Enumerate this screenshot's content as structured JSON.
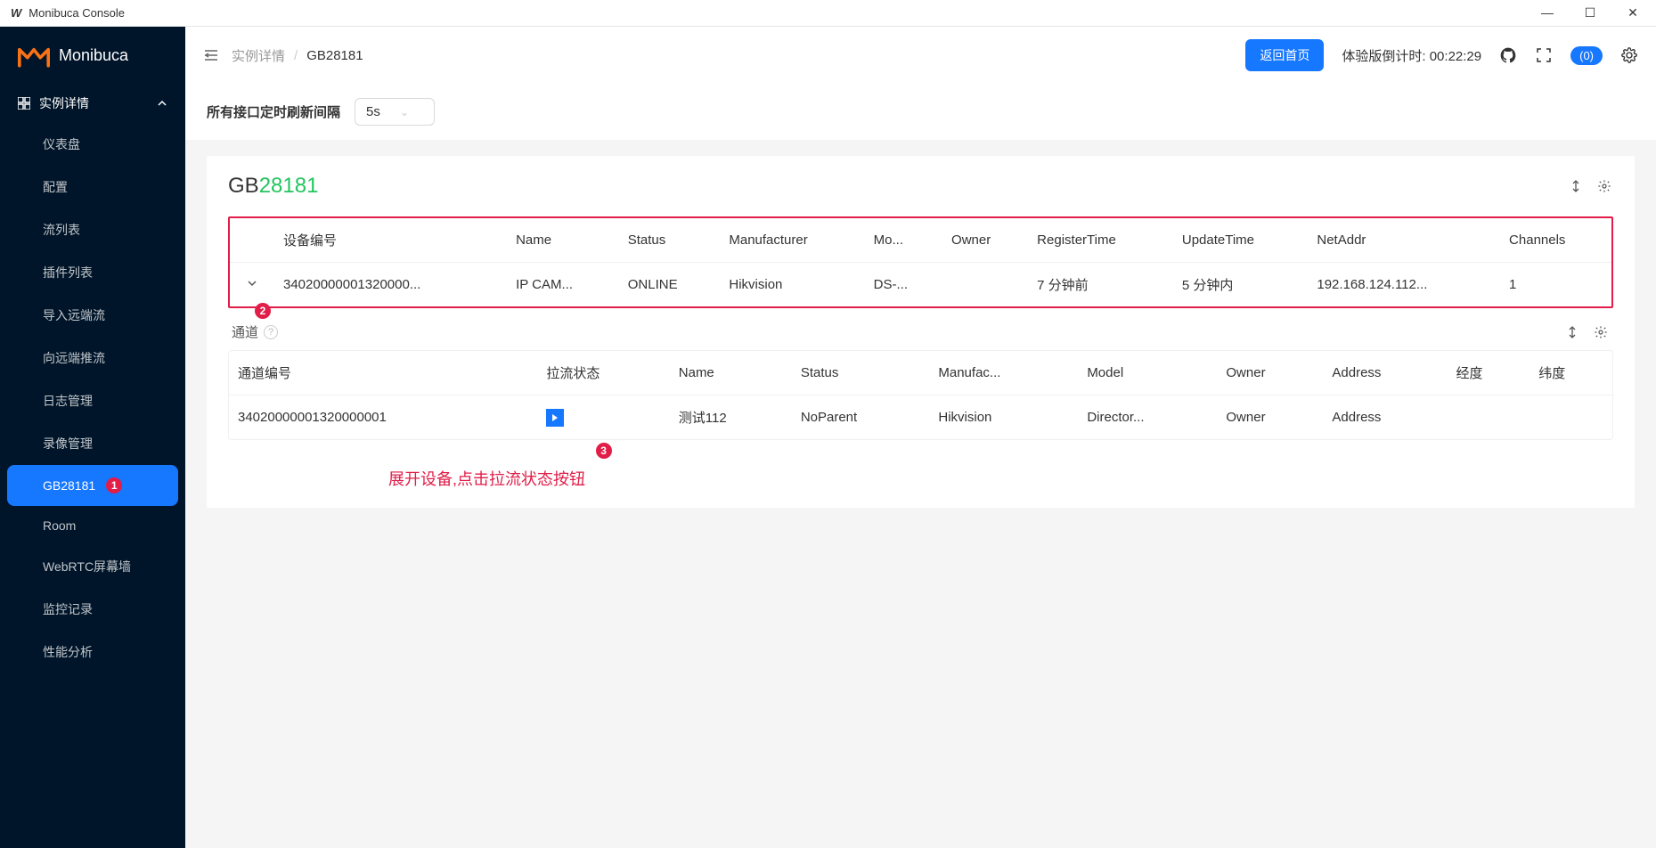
{
  "window": {
    "title": "Monibuca Console"
  },
  "brand": {
    "name": "Monibuca"
  },
  "sidebar": {
    "section": "实例详情",
    "items": [
      {
        "label": "仪表盘"
      },
      {
        "label": "配置"
      },
      {
        "label": "流列表"
      },
      {
        "label": "插件列表"
      },
      {
        "label": "导入远端流"
      },
      {
        "label": "向远端推流"
      },
      {
        "label": "日志管理"
      },
      {
        "label": "录像管理"
      },
      {
        "label": "GB28181"
      },
      {
        "label": "Room"
      },
      {
        "label": "WebRTC屏幕墙"
      },
      {
        "label": "监控记录"
      },
      {
        "label": "性能分析"
      }
    ]
  },
  "breadcrumb": {
    "parent": "实例详情",
    "current": "GB28181"
  },
  "header": {
    "home_btn": "返回首页",
    "countdown_label": "体验版倒计时:",
    "countdown_value": "00:22:29",
    "badge": "(0)"
  },
  "toolbar": {
    "refresh_label": "所有接口定时刷新间隔",
    "refresh_value": "5s"
  },
  "page": {
    "title_prefix": "GB",
    "title_suffix": "28181"
  },
  "device_table": {
    "headers": [
      "设备编号",
      "Name",
      "Status",
      "Manufacturer",
      "Mo...",
      "Owner",
      "RegisterTime",
      "UpdateTime",
      "NetAddr",
      "Channels"
    ],
    "row": {
      "id": "34020000001320000...",
      "name": "IP CAM...",
      "status": "ONLINE",
      "manufacturer": "Hikvision",
      "model": "DS-...",
      "owner": "",
      "register_time": "7 分钟前",
      "update_time": "5 分钟内",
      "netaddr": "192.168.124.112...",
      "channels": "1"
    }
  },
  "channel": {
    "title": "通道",
    "headers": [
      "通道编号",
      "拉流状态",
      "Name",
      "Status",
      "Manufac...",
      "Model",
      "Owner",
      "Address",
      "经度",
      "纬度"
    ],
    "row": {
      "id": "34020000001320000001",
      "name": "测试112",
      "status": "NoParent",
      "manufacturer": "Hikvision",
      "model": "Director...",
      "owner": "Owner",
      "address": "Address",
      "lon": "",
      "lat": ""
    }
  },
  "callouts": {
    "c1": "1",
    "c2": "2",
    "c3": "3"
  },
  "hint": "展开设备,点击拉流状态按钮"
}
